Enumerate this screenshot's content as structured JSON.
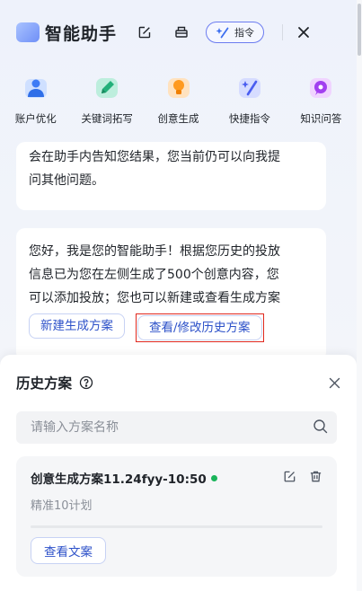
{
  "header": {
    "title": "智能助手",
    "command_label": "指令"
  },
  "shortcuts": [
    {
      "label": "账户优化",
      "icon": "account-person-icon"
    },
    {
      "label": "关键词拓写",
      "icon": "keyword-pen-icon"
    },
    {
      "label": "创意生成",
      "icon": "idea-lightbulb-icon"
    },
    {
      "label": "快捷指令",
      "icon": "sparkle-command-icon"
    },
    {
      "label": "知识问答",
      "icon": "knowledge-chat-icon"
    }
  ],
  "messages": {
    "first_lines": [
      "会在助手内告知您结果，您当前仍可以向我提",
      "问其他问题。"
    ],
    "second_lines": [
      "您好，我是您的智能助手！根据您历史的投放",
      "信息已为您在左侧生成了500个创意内容，您",
      "可以添加投放；您也可以新建或查看生成方案"
    ],
    "new_plan_label": "新建生成方案",
    "history_plan_label": "查看/修改历史方案"
  },
  "history_panel": {
    "title": "历史方案",
    "search_placeholder": "请输入方案名称",
    "card": {
      "title": "创意生成方案11.24fyy-10:50",
      "subtitle": "精准10计划",
      "view_label": "查看文案",
      "status_color": "#19b45a"
    }
  },
  "colors": {
    "accent": "#2e52c9",
    "highlight_border": "#e0281e"
  }
}
